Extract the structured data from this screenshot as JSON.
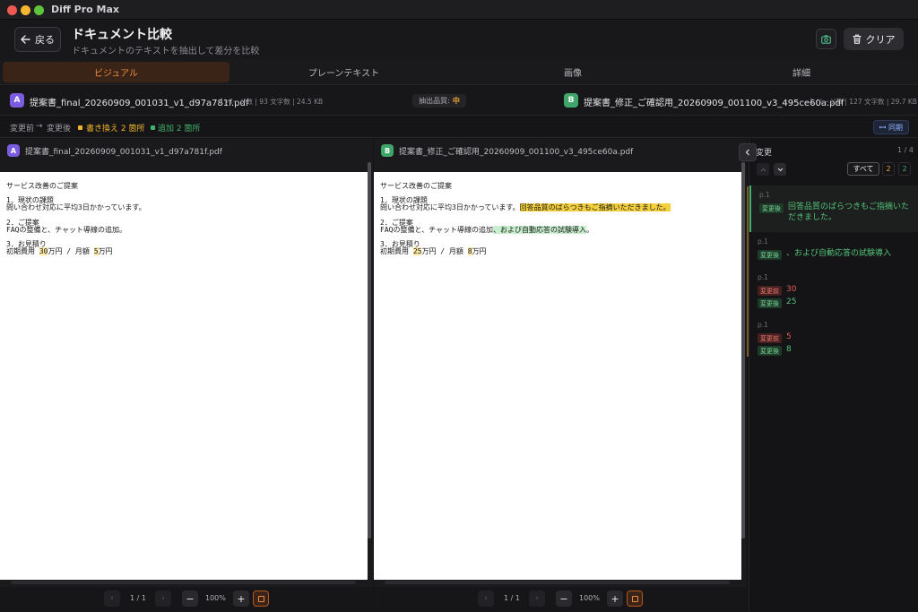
{
  "window": {
    "title": "Diff Pro Max"
  },
  "header": {
    "back_label": "戻る",
    "title": "ドキュメント比較",
    "subtitle": "ドキュメントのテキストを抽出して差分を比較",
    "clear_label": "クリア"
  },
  "tabs": [
    {
      "label": "ビジュアル",
      "active": true
    },
    {
      "label": "プレーンテキスト",
      "active": false
    },
    {
      "label": "画像",
      "active": false
    },
    {
      "label": "詳細",
      "active": false
    }
  ],
  "files": {
    "a": {
      "badge": "A",
      "name": "提案書_final_20260909_001031_v1_d97a781f.pdf",
      "meta": "1 ページ数 | 93 文字数 | 24.5 KB"
    },
    "b": {
      "badge": "B",
      "name": "提案書_修正_ご確認用_20260909_001100_v3_495ce60a.pdf",
      "meta": "1 ページ数 | 127 文字数 | 29.7 KB"
    },
    "quality_label": "抽出品質:",
    "quality_value": "中"
  },
  "legend": {
    "before": "変更前",
    "arrow": "→",
    "after": "変更後",
    "replace": "書き換え 2 箇所",
    "dot": "·",
    "add": "追加 2 箇所",
    "sync_label": "同期",
    "colors": {
      "replace": "#f0b429",
      "add": "#3fb36b"
    }
  },
  "doc_a": {
    "title": "サービス改善のご提案",
    "s1_head": "1．現状の課題",
    "s1_body": "問い合わせ対応に平均3日かかっています。",
    "s2_head": "2．ご提案",
    "s2_body": "FAQの整備と、チャット導線の追加。",
    "s3_head": "3．お見積り",
    "s3_pre": "初期費用 ",
    "s3_n1": "30",
    "s3_mid": "万円 / 月額 ",
    "s3_n2": "5",
    "s3_post": "万円"
  },
  "doc_b": {
    "title": "サービス改善のご提案",
    "s1_head": "1．現状の課題",
    "s1_body": "問い合わせ対応に平均3日かかっています。",
    "s1_added": "回答品質のばらつきもご指摘いただきました。",
    "s2_head": "2．ご提案",
    "s2_body": "FAQの整備と、チャット導線の追加",
    "s2_added": "、および自動応答の試験導入",
    "s2_end": "。",
    "s3_head": "3．お見積り",
    "s3_pre": "初期費用 ",
    "s3_n1": "25",
    "s3_mid": "万円 / 月額 ",
    "s3_n2": "8",
    "s3_post": "万円"
  },
  "pager": {
    "page": "1 / 1",
    "zoom": "100%",
    "prev": "‹",
    "next": "›",
    "minus": "−",
    "plus": "+"
  },
  "changes": {
    "title": "変更",
    "count": "1 / 4",
    "filter_all": "すべて",
    "filter_replace": "2",
    "filter_add": "2",
    "before_tag": "変更前",
    "after_tag": "変更後",
    "items": [
      {
        "page": "p.1",
        "after": "回答品質のばらつきもご指摘いた",
        "after2": "だきました。"
      },
      {
        "page": "p.1",
        "after": "、および自動応答の試験導入"
      },
      {
        "page": "p.1",
        "before": "30",
        "after": "25"
      },
      {
        "page": "p.1",
        "before": "5",
        "after": "8"
      }
    ]
  }
}
